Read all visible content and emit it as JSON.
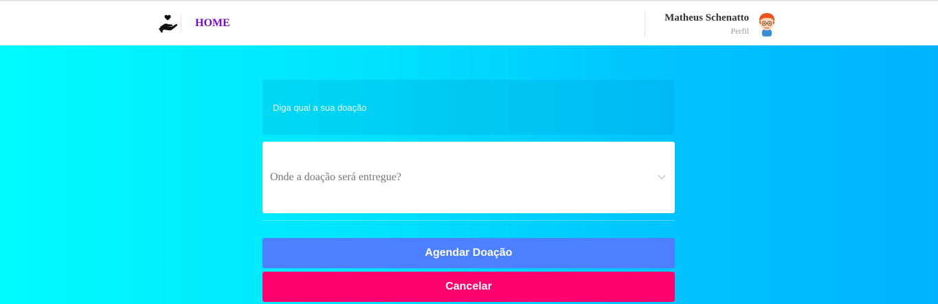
{
  "header": {
    "home_label": "HOME",
    "user": {
      "name": "Matheus Schenatto",
      "role": "Perfil"
    }
  },
  "form": {
    "donation_placeholder": "Diga qual a sua doação",
    "location_placeholder": "Onde a doação será entregue?",
    "schedule_label": "Agendar Doação",
    "cancel_label": "Cancelar"
  },
  "colors": {
    "home_link": "#7a0bc0",
    "schedule_button": "#4d80fe",
    "cancel_button": "#ff006e",
    "gradient_start": "#00fbff",
    "gradient_end": "#00b2ff"
  },
  "icons": {
    "logo": "hand-heart-icon",
    "avatar": "avatar-icon",
    "select_arrow": "chevron-down-icon"
  }
}
